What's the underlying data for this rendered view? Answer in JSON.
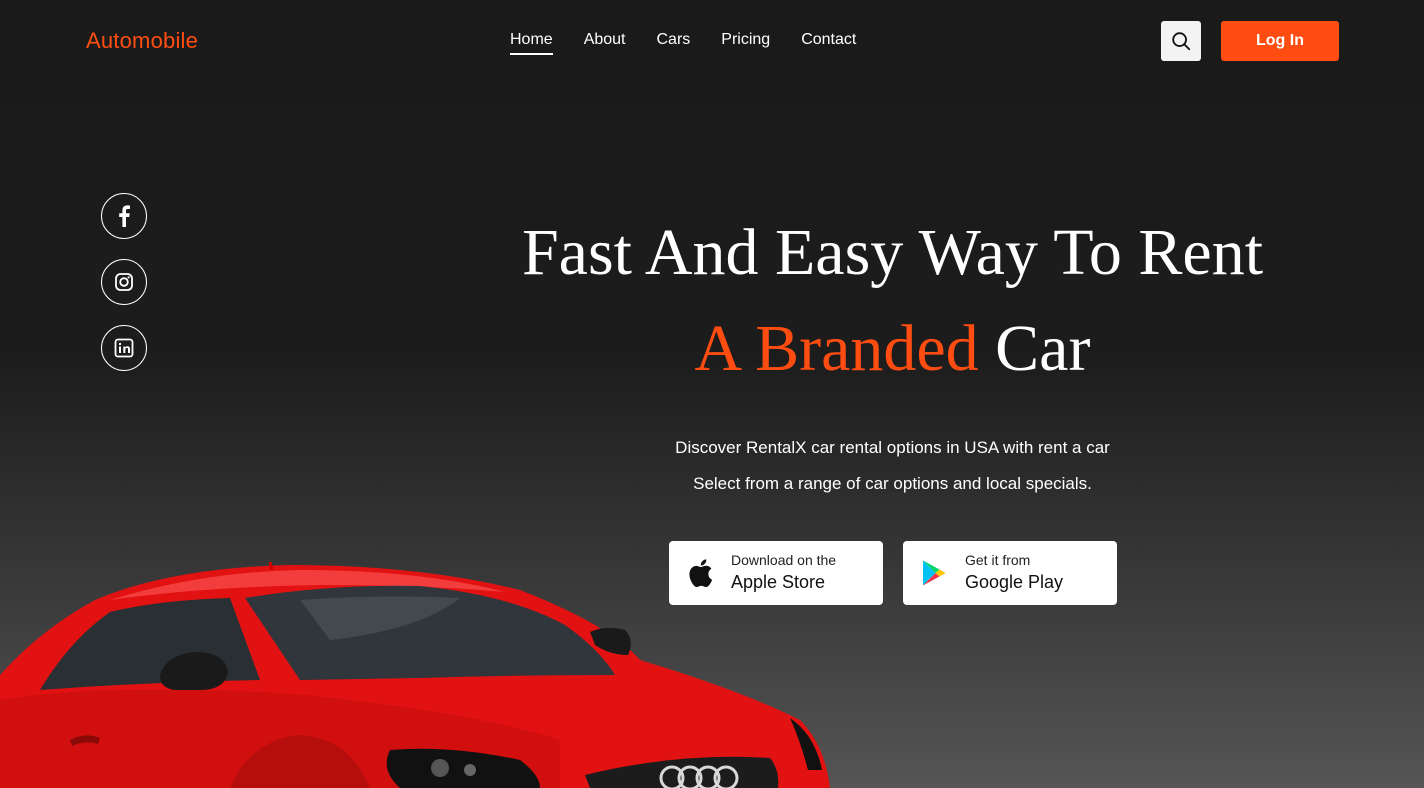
{
  "header": {
    "logo": "Automobile",
    "nav": [
      {
        "label": "Home",
        "active": true
      },
      {
        "label": "About"
      },
      {
        "label": "Cars"
      },
      {
        "label": "Pricing"
      },
      {
        "label": "Contact"
      }
    ],
    "search_icon": "search-icon",
    "login_label": "Log In"
  },
  "socials": [
    "facebook-icon",
    "instagram-icon",
    "linkedin-icon"
  ],
  "hero": {
    "title_line1": "Fast And Easy Way To Rent",
    "title_accent": "A Branded",
    "title_end": "Car",
    "desc_line1": "Discover RentalX car rental options in USA with rent a car",
    "desc_line2": "Select from a range of car options and local specials."
  },
  "stores": {
    "apple": {
      "small": "Download on the",
      "big": "Apple Store",
      "icon": "apple-icon"
    },
    "google": {
      "small": "Get it from",
      "big": "Google Play",
      "icon": "google-play-icon"
    }
  },
  "colors": {
    "accent": "#ff4d12",
    "background": "#1c1c1c"
  }
}
